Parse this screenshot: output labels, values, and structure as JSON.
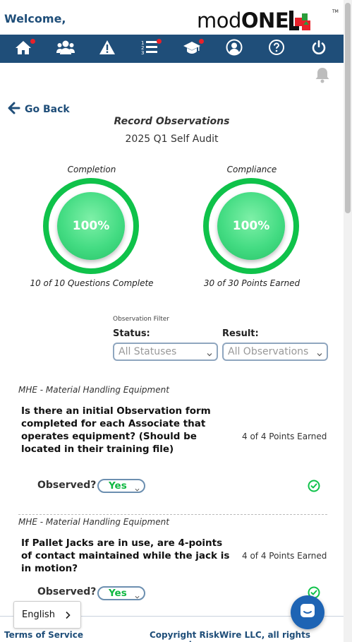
{
  "header": {
    "welcome": "Welcome,",
    "logo_mod": "mod",
    "logo_one": "ONE",
    "logo_tm": "TM"
  },
  "nav": {
    "items": [
      {
        "icon": "home-icon",
        "badge": true
      },
      {
        "icon": "users-icon",
        "badge": false
      },
      {
        "icon": "warning-icon",
        "badge": false
      },
      {
        "icon": "ordered-list-icon",
        "badge": true
      },
      {
        "icon": "graduation-cap-icon",
        "badge": true
      },
      {
        "icon": "user-circle-icon",
        "badge": false
      },
      {
        "icon": "help-icon",
        "badge": false
      },
      {
        "icon": "power-icon",
        "badge": false
      }
    ]
  },
  "go_back": "Go Back",
  "page_title": "Record Observations",
  "audit_name": "2025 Q1 Self Audit",
  "completion": {
    "label": "Completion",
    "value": "100%",
    "caption": "10 of 10 Questions Complete",
    "fraction": 1.0
  },
  "compliance": {
    "label": "Compliance",
    "value": "100%",
    "caption": "30 of 30 Points Earned",
    "fraction": 1.0
  },
  "filter": {
    "title": "Observation Filter",
    "status_label": "Status:",
    "status_value": "All Statuses",
    "result_label": "Result:",
    "result_value": "All Observations"
  },
  "questions": [
    {
      "category": "MHE - Material Handling Equipment",
      "text": "Is there an initial Observation form completed for each Associate that operates equipment? (Should be located in their training file)",
      "points": "4 of 4 Points Earned",
      "observed_label": "Observed?",
      "observed_value": "Yes"
    },
    {
      "category": "MHE - Material Handling Equipment",
      "text": "If Pallet Jacks are in use, are 4-points of contact maintained while the jack is in motion?",
      "points": "4 of 4 Points Earned",
      "observed_label": "Observed?",
      "observed_value": "Yes"
    }
  ],
  "language": "English",
  "footer": {
    "terms": "Terms of Service",
    "copyright": "Copyright RiskWire LLC, all rights reserved"
  },
  "colors": {
    "primary": "#1f4e79",
    "badge": "#e8212a",
    "success": "#0fc24a"
  }
}
